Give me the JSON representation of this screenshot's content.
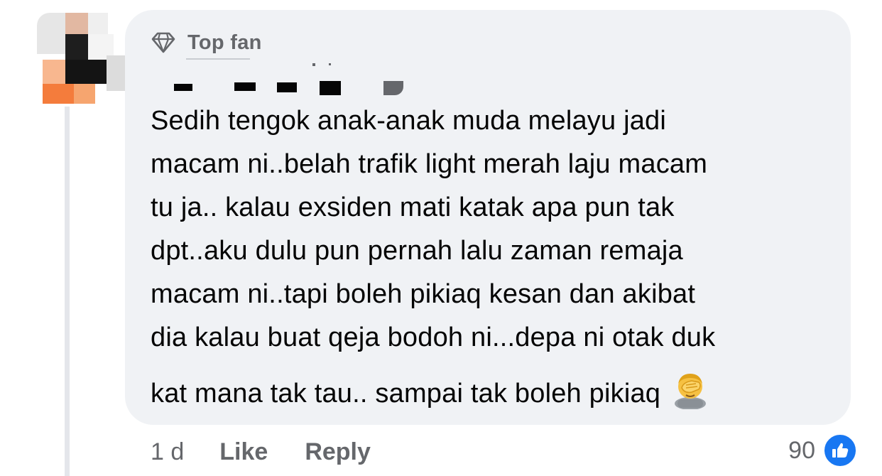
{
  "comment": {
    "badge_label": "Top fan",
    "badge_icon": "diamond-icon",
    "text_lines": [
      "Sedih tengok anak-anak muda melayu jadi",
      "macam ni..belah trafik light merah laju macam",
      "tu ja.. kalau exsiden mati katak apa pun tak",
      "dpt..aku dulu pun pernah lalu zaman remaja",
      "macam ni..tapi boleh pikiaq kesan dan akibat",
      "dia kalau buat qeja bodoh ni...depa ni otak duk",
      "kat mana tak tau.. sampai tak boleh pikiaq"
    ],
    "emoji": "facepalm-emoji",
    "colors": {
      "bubble": "#f0f2f5",
      "text": "#050505",
      "secondary": "#65676b",
      "like_blue": "#1877f2"
    }
  },
  "actions": {
    "time": "1 d",
    "like_label": "Like",
    "reply_label": "Reply"
  },
  "reactions": {
    "count": "90",
    "icon": "thumbs-up-icon"
  }
}
